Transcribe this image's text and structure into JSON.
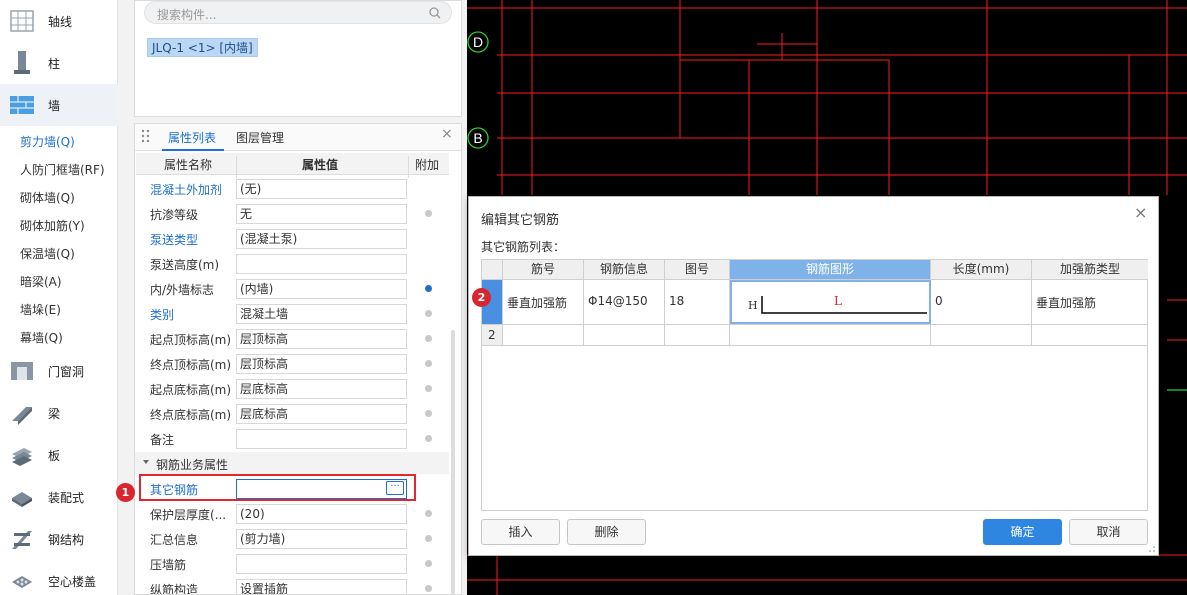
{
  "sidebar": {
    "categories": [
      {
        "label": "轴线",
        "icon": "axis-grid-icon"
      },
      {
        "label": "柱",
        "icon": "column-icon"
      },
      {
        "label": "墙",
        "icon": "wall-icon"
      },
      {
        "label": "门窗洞",
        "icon": "door-window-icon"
      },
      {
        "label": "梁",
        "icon": "beam-icon"
      },
      {
        "label": "板",
        "icon": "slab-icon"
      },
      {
        "label": "装配式",
        "icon": "prefab-icon"
      },
      {
        "label": "钢结构",
        "icon": "steel-structure-icon"
      },
      {
        "label": "空心楼盖",
        "icon": "hollow-floor-icon"
      }
    ],
    "wall_items": [
      "剪力墙(Q)",
      "人防门框墙(RF)",
      "砌体墙(Q)",
      "砌体加筋(Y)",
      "保温墙(Q)",
      "暗梁(A)",
      "墙垛(E)",
      "幕墙(Q)"
    ],
    "selected_item": "剪力墙(Q)"
  },
  "component_panel": {
    "search_placeholder": "搜索构件...",
    "component": "JLQ-1 <1> [内墙]"
  },
  "property_panel": {
    "tabs": [
      "属性列表",
      "图层管理"
    ],
    "headers": [
      "属性名称",
      "属性值",
      "附加"
    ],
    "rows": [
      {
        "name": "混凝土外加剂",
        "value": "(无)"
      },
      {
        "name": "抗渗等级",
        "value": "无"
      },
      {
        "name": "泵送类型",
        "value": "(混凝土泵)"
      },
      {
        "name": "泵送高度(m)",
        "value": ""
      },
      {
        "name": "内/外墙标志",
        "value": "(内墙)"
      },
      {
        "name": "类别",
        "value": "混凝土墙"
      },
      {
        "name": "起点顶标高(m)",
        "value": "层顶标高"
      },
      {
        "name": "终点顶标高(m)",
        "value": "层顶标高"
      },
      {
        "name": "起点底标高(m)",
        "value": "层底标高"
      },
      {
        "name": "终点底标高(m)",
        "value": "层底标高"
      },
      {
        "name": "备注",
        "value": ""
      }
    ],
    "group": "钢筋业务属性",
    "group_rows": [
      {
        "name": "其它钢筋",
        "value": ""
      },
      {
        "name": "保护层厚度(...",
        "value": "(20)"
      },
      {
        "name": "汇总信息",
        "value": "(剪力墙)"
      },
      {
        "name": "压墙筋",
        "value": ""
      },
      {
        "name": "纵筋构造",
        "value": "设置插筋"
      }
    ]
  },
  "annotations": {
    "badge1": "1",
    "badge2": "2"
  },
  "canvas": {
    "axis_labels": [
      "D",
      "B"
    ],
    "colors": {
      "background": "#000000",
      "lines": "#ff1a1a",
      "axis_circle": "#2bd12b"
    }
  },
  "dialog": {
    "title": "编辑其它钢筋",
    "list_label": "其它钢筋列表：",
    "columns": [
      "筋号",
      "钢筋信息",
      "图号",
      "钢筋图形",
      "长度(mm)",
      "加强筋类型"
    ],
    "rows": [
      {
        "num": "1",
        "bar_no": "垂直加强筋",
        "info": "Φ14@150",
        "fig": "18",
        "shape_h": "H",
        "shape_l": "L",
        "length": "0",
        "type": "垂直加强筋"
      },
      {
        "num": "2",
        "bar_no": "",
        "info": "",
        "fig": "",
        "shape_h": "",
        "shape_l": "",
        "length": "",
        "type": ""
      }
    ],
    "buttons": {
      "insert": "插入",
      "delete": "删除",
      "ok": "确定",
      "cancel": "取消"
    }
  }
}
